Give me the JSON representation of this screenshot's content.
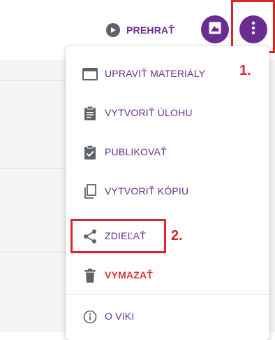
{
  "toolbar": {
    "play_label": "PREHRAŤ",
    "play_icon": "play-circle-icon",
    "image_button_icon": "image-icon",
    "more_button_icon": "more-vertical-icon",
    "accent_color": "#6a2d8f"
  },
  "annotations": {
    "step1": "1.",
    "step2": "2.",
    "color": "#d9252b"
  },
  "menu": {
    "items": [
      {
        "label": "UPRAVIŤ MATERIÁLY",
        "icon": "window-icon"
      },
      {
        "label": "VYTVORIŤ ÚLOHU",
        "icon": "clipboard-list-icon"
      },
      {
        "label": "PUBLIKOVAŤ",
        "icon": "clipboard-check-icon"
      },
      {
        "label": "VYTVORIŤ KÓPIU",
        "icon": "copy-icon"
      },
      {
        "label": "ZDIEĽAŤ",
        "icon": "share-icon"
      },
      {
        "label": "VYMAZAŤ",
        "icon": "trash-icon",
        "color": "#e0352b"
      },
      {
        "label": "O VIKI",
        "icon": "info-icon"
      }
    ]
  }
}
